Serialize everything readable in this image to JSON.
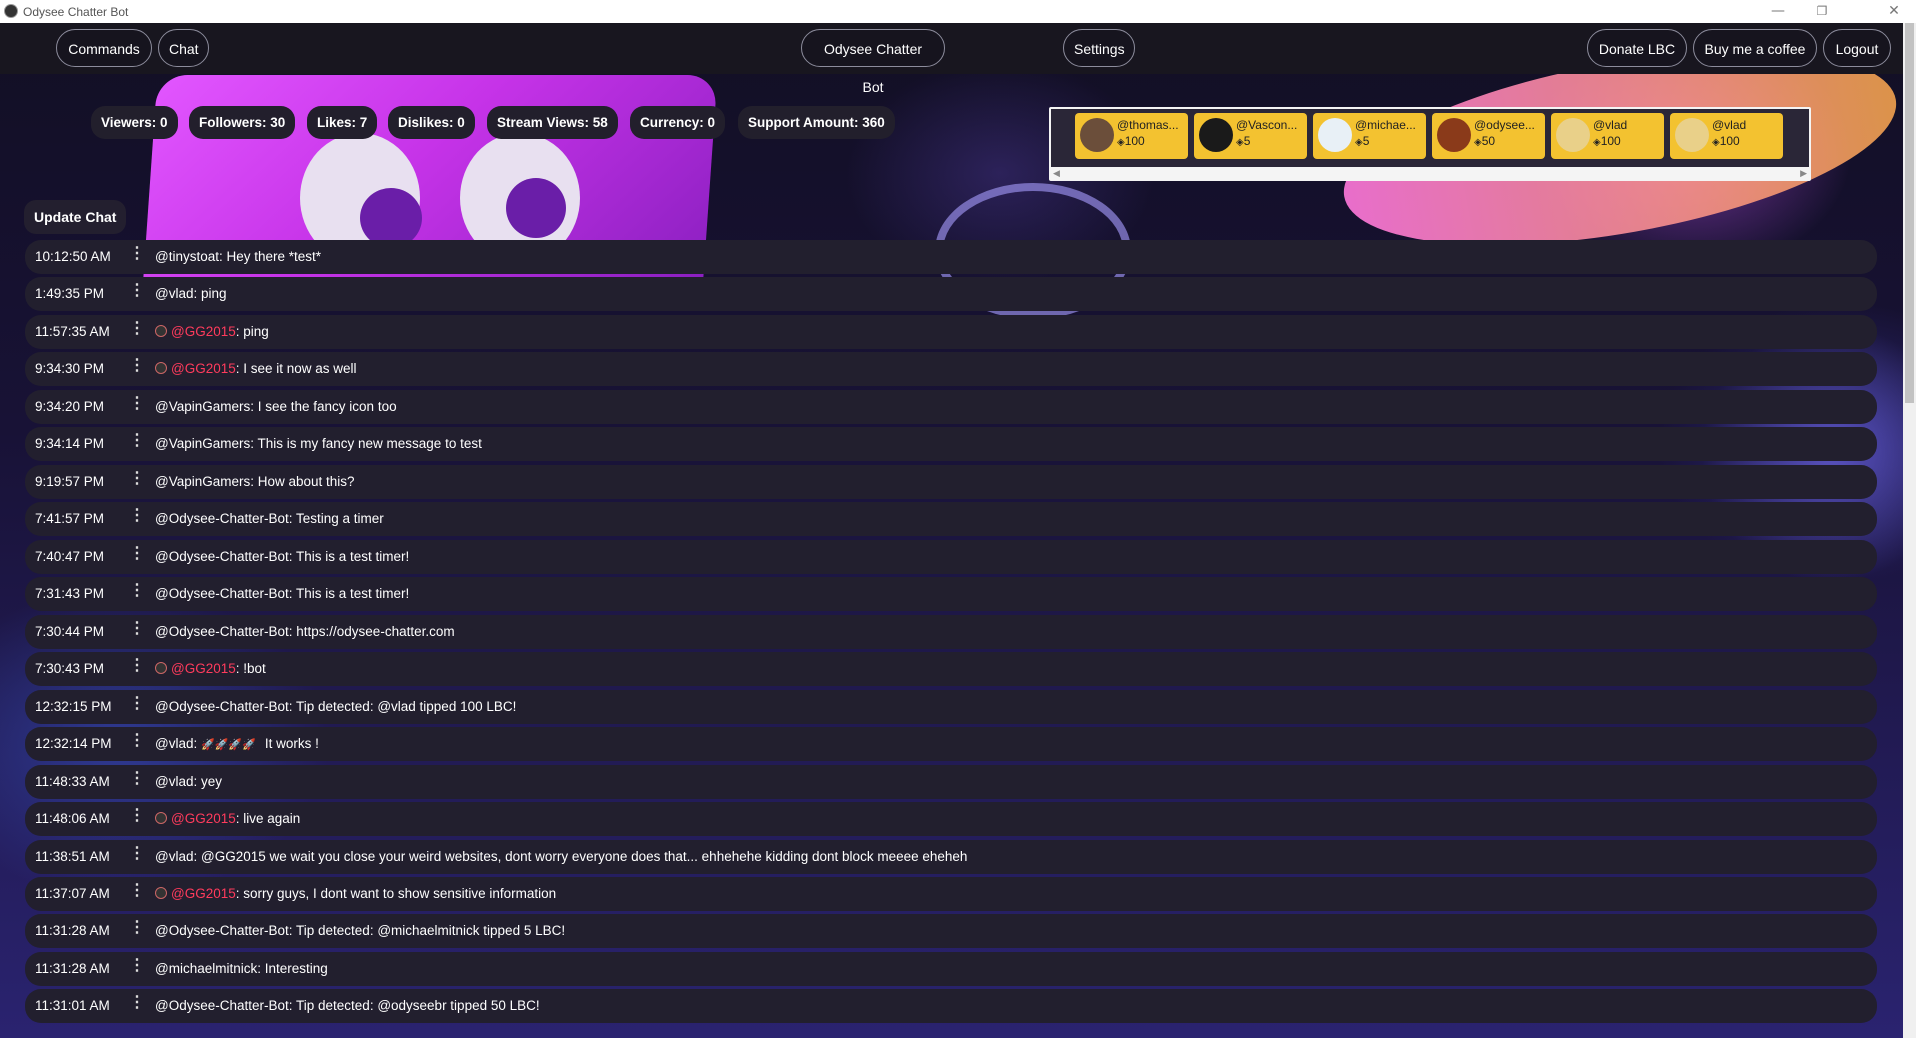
{
  "window": {
    "title": "Odysee Chatter Bot",
    "minimize": "—",
    "maximize": "❐",
    "close": "✕"
  },
  "nav": {
    "commands": "Commands",
    "chat": "Chat",
    "brand": "Odysee Chatter Bot",
    "settings": "Settings",
    "donate": "Donate LBC",
    "coffee": "Buy me a coffee",
    "logout": "Logout"
  },
  "stats": [
    {
      "label": "Viewers: 0"
    },
    {
      "label": "Followers: 30"
    },
    {
      "label": "Likes: 7"
    },
    {
      "label": "Dislikes: 0"
    },
    {
      "label": "Stream Views: 58"
    },
    {
      "label": "Currency: 0"
    },
    {
      "label": "Support Amount: 360"
    }
  ],
  "tips": [
    {
      "name": "@thomas...",
      "amount": "100"
    },
    {
      "name": "@Vascon...",
      "amount": "5"
    },
    {
      "name": "@michae...",
      "amount": "5"
    },
    {
      "name": "@odysee...",
      "amount": "50"
    },
    {
      "name": "@vlad",
      "amount": "100"
    },
    {
      "name": "@vlad",
      "amount": "100"
    }
  ],
  "lbc_symbol": "◈",
  "update_chat": "Update Chat",
  "menu_glyph": "⋮",
  "colors": {
    "tip_card": "#f3c230",
    "mod_name": "#ff3b5c",
    "msg_bg": "#221f2e"
  },
  "messages": [
    {
      "time": "10:12:50 AM",
      "user": "@tinystoat",
      "text": ": Hey there *test*"
    },
    {
      "time": "1:49:35 PM",
      "user": "@vlad",
      "text": ": ping"
    },
    {
      "time": "11:57:35 AM",
      "user": "@GG2015",
      "text": ": ping",
      "badge": true
    },
    {
      "time": "9:34:30 PM",
      "user": "@GG2015",
      "text": ": I see it now as well",
      "badge": true
    },
    {
      "time": "9:34:20 PM",
      "user": "@VapinGamers",
      "text": ": I see the fancy icon too"
    },
    {
      "time": "9:34:14 PM",
      "user": "@VapinGamers",
      "text": ": This is my fancy new message to test"
    },
    {
      "time": "9:19:57 PM",
      "user": "@VapinGamers",
      "text": ": How about this?"
    },
    {
      "time": "7:41:57 PM",
      "user": "@Odysee-Chatter-Bot",
      "text": ": Testing a timer"
    },
    {
      "time": "7:40:47 PM",
      "user": "@Odysee-Chatter-Bot",
      "text": ": This is a test timer!"
    },
    {
      "time": "7:31:43 PM",
      "user": "@Odysee-Chatter-Bot",
      "text": ": This is a test timer!"
    },
    {
      "time": "7:30:44 PM",
      "user": "@Odysee-Chatter-Bot",
      "text": ": https://odysee-chatter.com"
    },
    {
      "time": "7:30:43 PM",
      "user": "@GG2015",
      "text": ": !bot",
      "badge": true
    },
    {
      "time": "12:32:15 PM",
      "user": "@Odysee-Chatter-Bot",
      "text": ": Tip detected: @vlad tipped 100 LBC!"
    },
    {
      "time": "12:32:14 PM",
      "user": "@vlad",
      "text": ":",
      "rockets": "🚀🚀🚀🚀",
      "after": "It works !"
    },
    {
      "time": "11:48:33 AM",
      "user": "@vlad",
      "text": ": yey"
    },
    {
      "time": "11:48:06 AM",
      "user": "@GG2015",
      "text": ": live again",
      "badge": true
    },
    {
      "time": "11:38:51 AM",
      "user": "@vlad",
      "text": ": @GG2015 we wait you close your weird websites, dont worry everyone does that... ehhehehe kidding dont block meeee eheheh"
    },
    {
      "time": "11:37:07 AM",
      "user": "@GG2015",
      "text": ": sorry guys, I dont want to show sensitive information",
      "badge": true
    },
    {
      "time": "11:31:28 AM",
      "user": "@Odysee-Chatter-Bot",
      "text": ": Tip detected: @michaelmitnick tipped 5 LBC!"
    },
    {
      "time": "11:31:28 AM",
      "user": "@michaelmitnick",
      "text": ": Interesting"
    },
    {
      "time": "11:31:01 AM",
      "user": "@Odysee-Chatter-Bot",
      "text": ": Tip detected: @odyseebr tipped 50 LBC!"
    }
  ]
}
